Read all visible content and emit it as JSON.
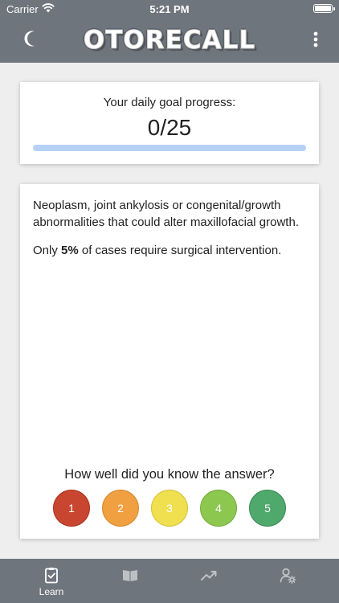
{
  "status_bar": {
    "carrier": "Carrier",
    "time": "5:21 PM"
  },
  "header": {
    "title": "OTORECALL"
  },
  "progress": {
    "label": "Your daily goal progress:",
    "count": "0/25",
    "fraction": 0
  },
  "question": {
    "paragraph1": "Neoplasm, joint ankylosis or congenital/growth abnormalities that could alter maxillofacial growth.",
    "paragraph2_before": "Only ",
    "paragraph2_bold": "5%",
    "paragraph2_after": " of cases require surgical intervention.",
    "prompt": "How well did you know the answer?"
  },
  "ratings": [
    {
      "label": "1",
      "color": "#c8452f",
      "border": "#a8331f"
    },
    {
      "label": "2",
      "color": "#f0a040",
      "border": "#d48a2c"
    },
    {
      "label": "3",
      "color": "#f0e050",
      "border": "#d4c23a"
    },
    {
      "label": "4",
      "color": "#8cc850",
      "border": "#72ab3a"
    },
    {
      "label": "5",
      "color": "#4fa86c",
      "border": "#3a8c55"
    }
  ],
  "tabs": [
    {
      "label": "Learn",
      "icon": "clipboard-check-icon",
      "active": true
    },
    {
      "label": "",
      "icon": "book-open-icon",
      "active": false
    },
    {
      "label": "",
      "icon": "trend-up-icon",
      "active": false
    },
    {
      "label": "",
      "icon": "user-settings-icon",
      "active": false
    }
  ],
  "colors": {
    "header_bg": "#6f757c",
    "progress_track": "#b7d1f5",
    "background": "#eeeeee"
  }
}
